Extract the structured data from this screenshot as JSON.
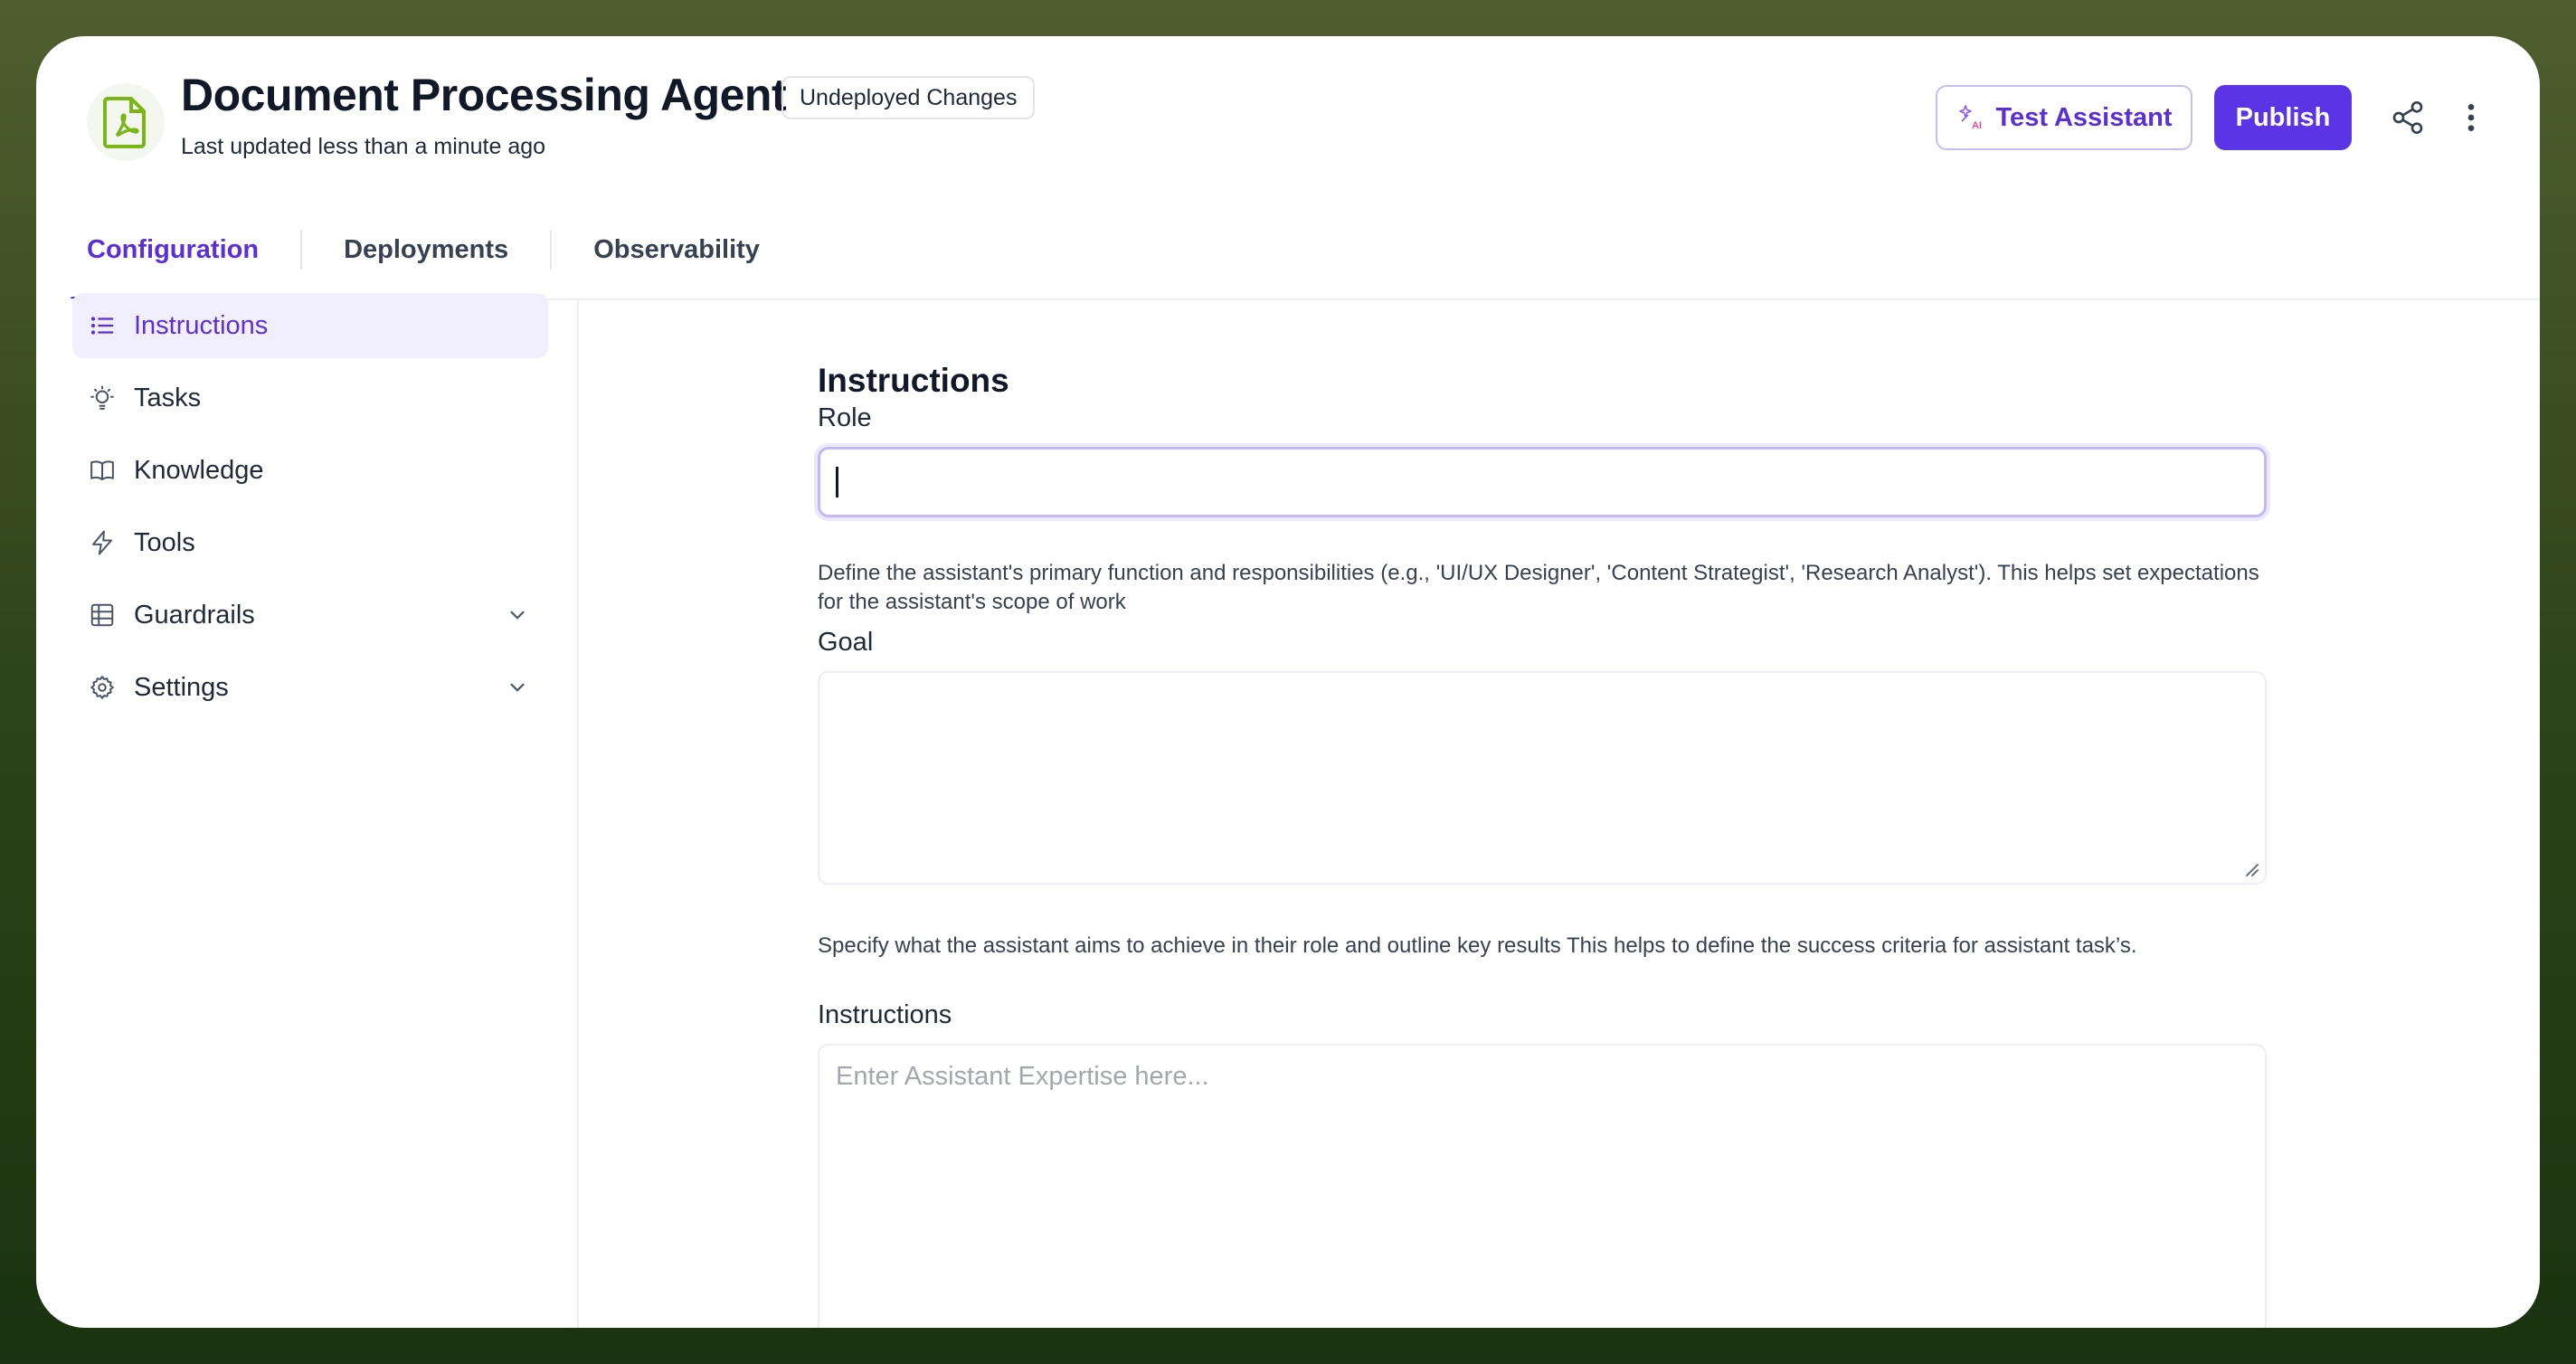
{
  "header": {
    "title": "Document Processing Agent",
    "badge": "Undeployed Changes",
    "subtitle": "Last updated less than a minute ago",
    "app_icon": "pdf-document-icon",
    "test_button_label": "Test Assistant",
    "publish_button_label": "Publish",
    "share_icon": "share-icon",
    "more_icon": "more-vertical-icon"
  },
  "tabs": [
    {
      "label": "Configuration",
      "active": true
    },
    {
      "label": "Deployments",
      "active": false
    },
    {
      "label": "Observability",
      "active": false
    }
  ],
  "sidebar": {
    "items": [
      {
        "label": "Instructions",
        "icon": "list-icon",
        "active": true
      },
      {
        "label": "Tasks",
        "icon": "lightbulb-icon"
      },
      {
        "label": "Knowledge",
        "icon": "book-icon"
      },
      {
        "label": "Tools",
        "icon": "lightning-icon"
      },
      {
        "label": "Guardrails",
        "icon": "table-icon",
        "expandable": true
      },
      {
        "label": "Settings",
        "icon": "gear-icon",
        "expandable": true
      }
    ]
  },
  "form": {
    "section_title": "Instructions",
    "role": {
      "label": "Role",
      "value": "",
      "help": "Define the assistant's primary function and responsibilities (e.g., 'UI/UX Designer', 'Content Strategist', 'Research Analyst'). This helps set expectations for the assistant's scope of work"
    },
    "goal": {
      "label": "Goal",
      "value": "",
      "help": "Specify what the assistant aims to achieve in their role and outline key results This helps to define the success criteria for assistant task’s."
    },
    "instructions": {
      "label": "Instructions",
      "value": "",
      "placeholder": "Enter Assistant Expertise here..."
    }
  },
  "colors": {
    "accent": "#5b34e6",
    "frame_top": "#4f5e2e",
    "frame_bottom": "#1a3310",
    "pdf_icon": "#7cb518"
  }
}
